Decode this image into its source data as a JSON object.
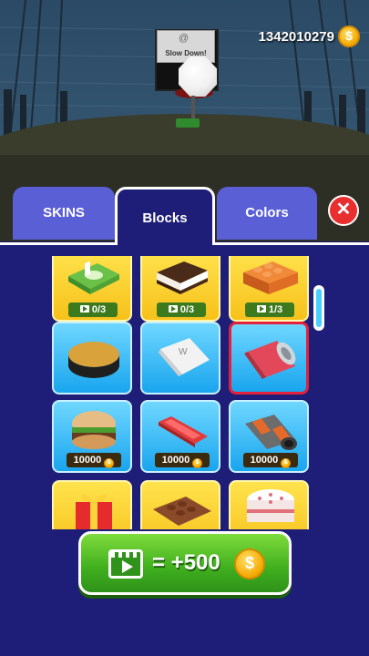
{
  "hud": {
    "coins": "1342010279",
    "coin_symbol": "$",
    "sign_text": "Slow Down!"
  },
  "tabs": {
    "skins": "SKINS",
    "blocks": "Blocks",
    "colors": "Colors",
    "active": "Blocks",
    "close_symbol": "✕"
  },
  "shop": {
    "row1": [
      {
        "item": "money-stack",
        "progress": "0/3"
      },
      {
        "item": "ice-cream-sandwich",
        "progress": "0/3"
      },
      {
        "item": "lego-brick",
        "progress": "1/3"
      }
    ],
    "row2": [
      {
        "item": "burger-patty-block",
        "state": "owned"
      },
      {
        "item": "paper-wedge-block",
        "state": "owned"
      },
      {
        "item": "soda-can-block",
        "state": "selected"
      }
    ],
    "row3": [
      {
        "item": "burger",
        "price": "10000"
      },
      {
        "item": "skateboard",
        "price": "10000"
      },
      {
        "item": "pipe",
        "price": "10000"
      }
    ],
    "row4": [
      {
        "item": "gift-box"
      },
      {
        "item": "chocolate-bar"
      },
      {
        "item": "cake"
      }
    ]
  },
  "ad_button": {
    "text": "= +500",
    "coin_symbol": "$"
  },
  "colors": {
    "tab_inactive": "#5b5fd6",
    "tab_active": "#1e1e78",
    "shop_bg": "#1e1e78",
    "ad_green": "#3fae1e",
    "close_red": "#e82e2e",
    "coin_gold": "#f5a800"
  }
}
